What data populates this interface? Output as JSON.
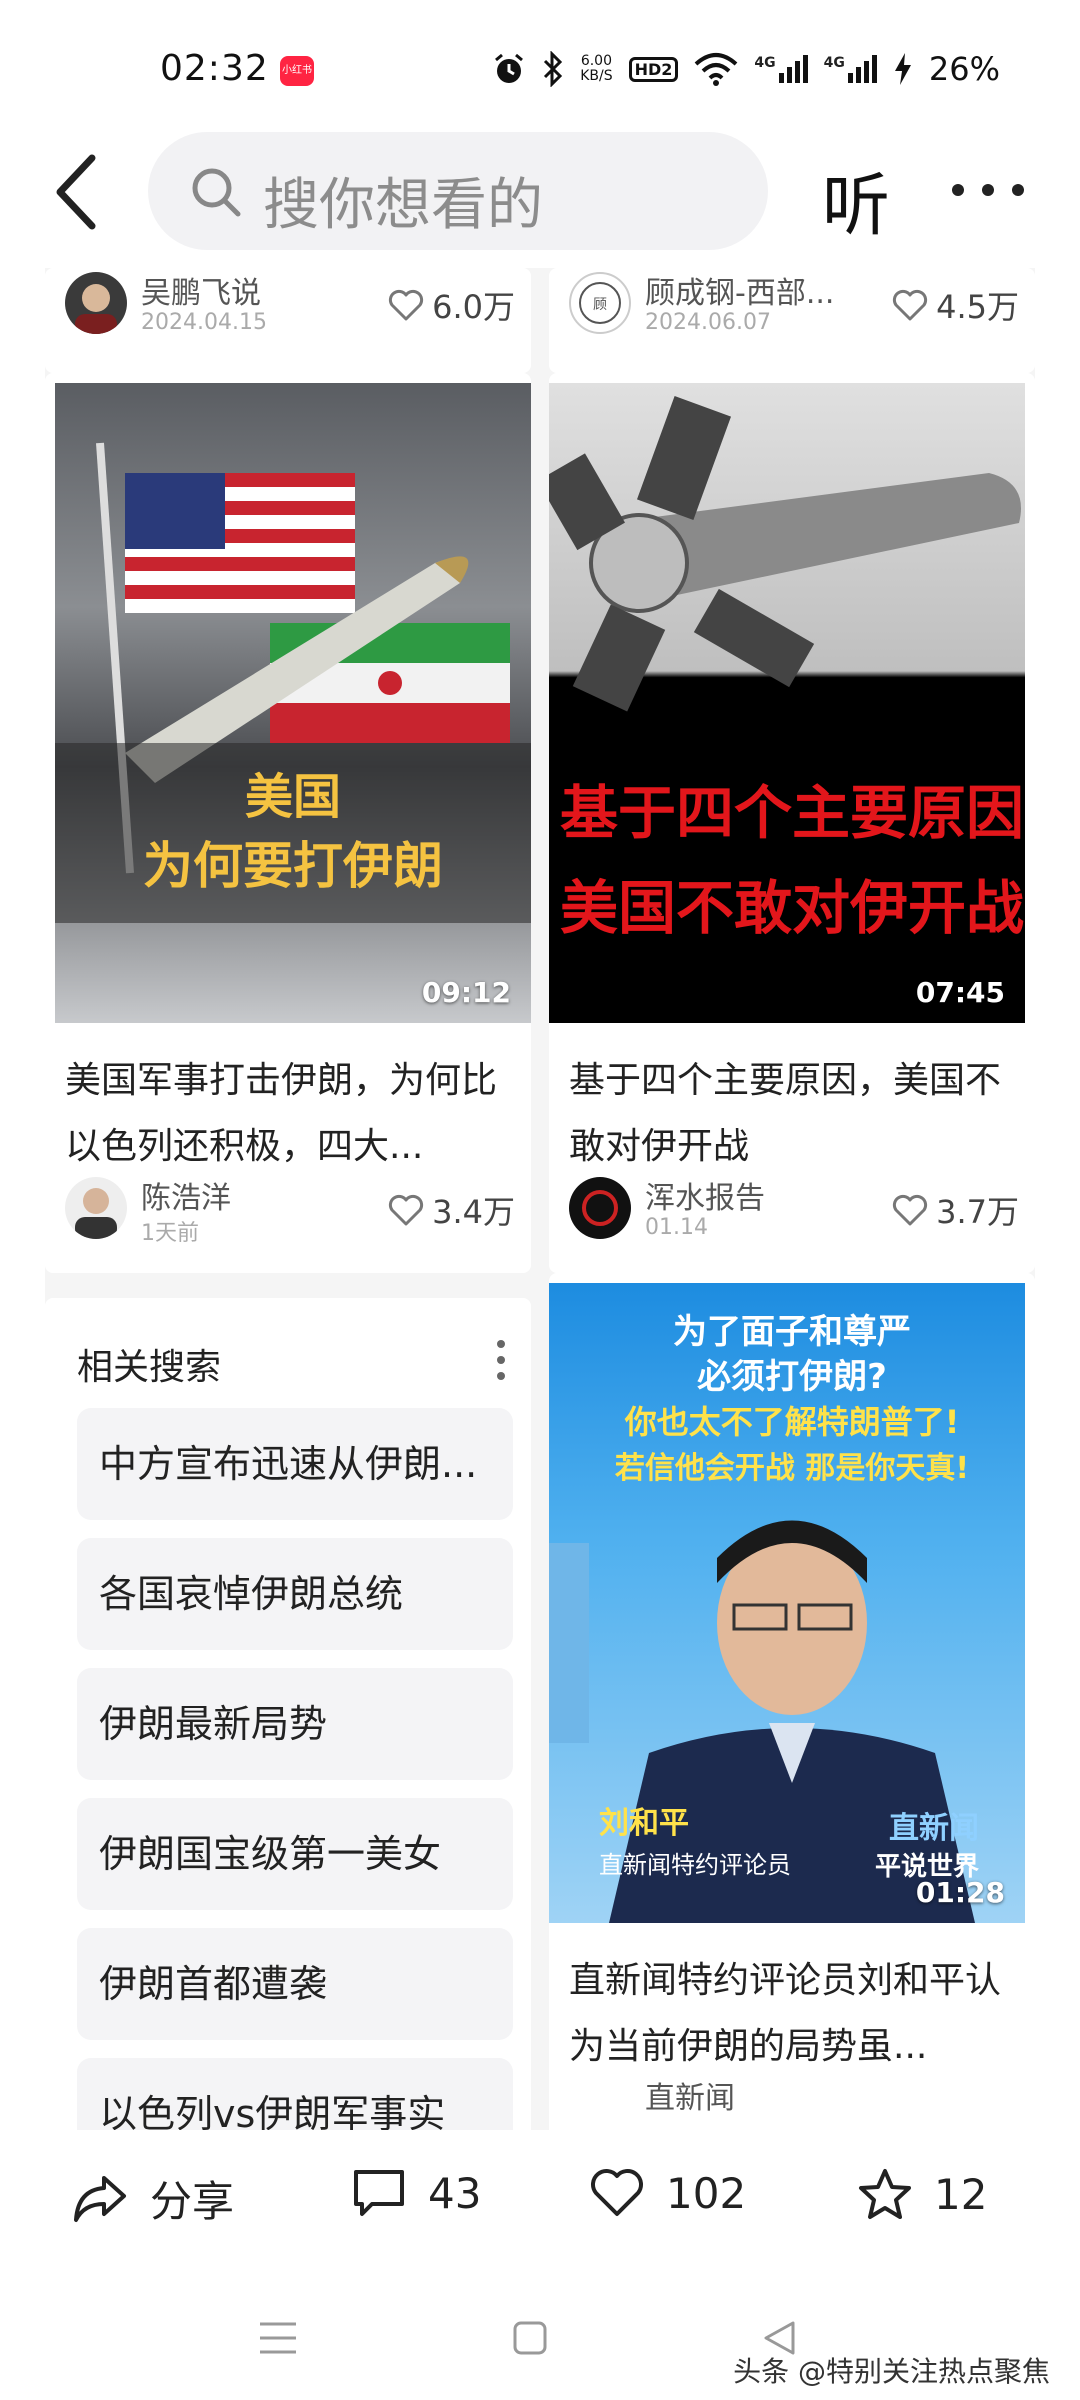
{
  "status_bar": {
    "time": "02:32",
    "app_badge": "小红书",
    "net_speed_value": "6.00",
    "net_speed_unit": "KB/S",
    "hd_label": "HD2",
    "signal_label_1": "4G",
    "signal_label_2": "4G",
    "battery": "26%"
  },
  "nav": {
    "search_placeholder": "搜你想看的",
    "listen_label": "听"
  },
  "feed": {
    "top_left": {
      "author": "吴鹏飞说",
      "date": "2024.04.15",
      "likes": "6.0万"
    },
    "top_right": {
      "author": "顾成钢-西部...",
      "date": "2024.06.07",
      "likes": "4.5万"
    },
    "cards": [
      {
        "thumb_caption_1": "美国",
        "thumb_caption_2": "为何要打伊朗",
        "duration": "09:12",
        "title": "美国军事打击伊朗，为何比以色列还积极，四大...",
        "author": "陈浩洋",
        "date": "1天前",
        "likes": "3.4万"
      },
      {
        "thumb_caption_1": "基于四个主要原因",
        "thumb_caption_2": "美国不敢对伊开战",
        "duration": "07:45",
        "title": "基于四个主要原因，美国不敢对伊开战",
        "author": "浑水报告",
        "date": "01.14",
        "likes": "3.7万"
      },
      {
        "thumb_caption_1": "为了面子和尊严",
        "thumb_caption_2": "必须打伊朗?",
        "thumb_caption_3": "你也太不了解特朗普了!",
        "thumb_caption_4": "若信他会开战 那是你天真!",
        "lower_third_name": "刘和平",
        "lower_third_role": "直新闻特约评论员",
        "logo_1": "直新闻",
        "logo_2": "平说世界",
        "duration": "01:28",
        "title": "直新闻特约评论员刘和平认为当前伊朗的局势虽...",
        "author": "直新闻"
      }
    ]
  },
  "related": {
    "title": "相关搜索",
    "items": [
      "中方宣布迅速从伊朗...",
      "各国哀悼伊朗总统",
      "伊朗最新局势",
      "伊朗国宝级第一美女",
      "伊朗首都遭袭",
      "以色列vs伊朗军事实"
    ]
  },
  "actions": {
    "share_label": "分享",
    "comments": "43",
    "likes": "102",
    "favorites": "12"
  },
  "watermark": "头条 @特别关注热点聚焦",
  "colors": {
    "brand_red": "#ff2442",
    "search_bg": "#f2f2f4",
    "chip_bg": "#f4f4f6"
  }
}
